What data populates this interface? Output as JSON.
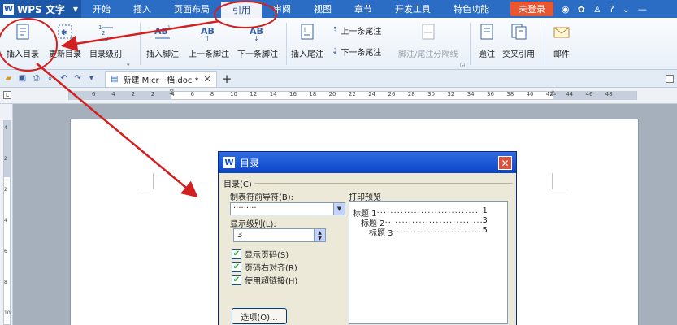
{
  "app": {
    "name": "WPS 文字"
  },
  "menu": {
    "tabs": [
      "开始",
      "插入",
      "页面布局",
      "引用",
      "审阅",
      "视图",
      "章节",
      "开发工具",
      "特色功能"
    ],
    "active_tab": "引用",
    "login": "未登录"
  },
  "ribbon": {
    "insert_toc": "插入目录",
    "update_toc": "更新目录",
    "toc_level": "目录级别",
    "insert_footnote": "插入脚注",
    "prev_footnote": "上一条脚注",
    "next_footnote": "下一条脚注",
    "insert_endnote": "插入尾注",
    "prev_endnote": "上一条尾注",
    "next_endnote": "下一条尾注",
    "separator": "脚注/尾注分隔线",
    "caption": "题注",
    "cross_ref": "交叉引用",
    "mail": "邮件"
  },
  "doc_tab": {
    "name": "新建 Micr···档.doc *"
  },
  "ruler": {
    "numbers": [
      "6",
      "4",
      "2",
      "2",
      "4",
      "6",
      "8",
      "10",
      "12",
      "14",
      "16",
      "18",
      "20",
      "22",
      "24",
      "26",
      "28",
      "30",
      "32",
      "34",
      "36",
      "38",
      "40",
      "42",
      "44",
      "46",
      "48"
    ]
  },
  "vruler": {
    "numbers": [
      "4",
      "2",
      "2",
      "4",
      "6",
      "8",
      "10"
    ]
  },
  "dialog": {
    "title": "目录",
    "group": "目录(C)",
    "leader_label": "制表符前导符(B):",
    "leader_value": "·········",
    "level_label": "显示级别(L):",
    "level_value": "3",
    "options": [
      {
        "label": "显示页码(S)",
        "checked": true
      },
      {
        "label": "页码右对齐(R)",
        "checked": true
      },
      {
        "label": "使用超链接(H)",
        "checked": true
      }
    ],
    "options_button": "选项(O)...",
    "preview_label": "打印预览",
    "preview": [
      {
        "text": "标题 1",
        "dots": "..............................................",
        "page": "1"
      },
      {
        "text": "标题 2",
        "dots": "............................................",
        "page": "3"
      },
      {
        "text": "标题 3",
        "dots": "........................................",
        "page": "5"
      }
    ]
  },
  "colors": {
    "menubar": "#2b6cc4",
    "annotation": "#d21f1f",
    "dialog_title": "#0b46c8"
  }
}
